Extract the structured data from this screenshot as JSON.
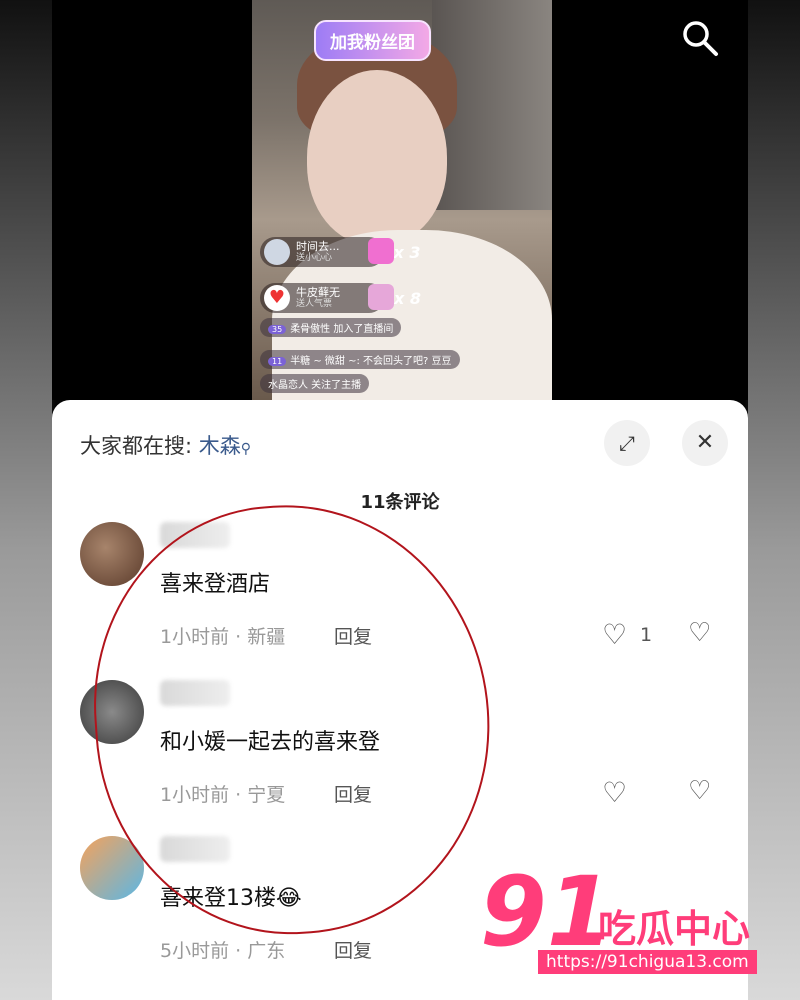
{
  "live": {
    "fan_badge": "加我粉丝团",
    "gifts": [
      {
        "title": "时间去...",
        "sub": "送小心心",
        "mult": "x 3"
      },
      {
        "title": "牛皮藓无",
        "sub": "送人气票",
        "mult": "x 8"
      }
    ],
    "chat": [
      {
        "level": "35",
        "text": "柔骨傲性 加入了直播间"
      },
      {
        "level": "11",
        "text": "半糖 ~ 微甜 ~: 不会回头了吧? 豆豆"
      },
      {
        "level": "",
        "text": "水晶恋人 关注了主播"
      }
    ]
  },
  "sheet": {
    "search_prefix": "大家都在搜:",
    "search_keyword": "木森",
    "comment_count": "11条评论",
    "comments": [
      {
        "text": "喜来登酒店",
        "meta": "1小时前 · 新疆",
        "reply": "回复",
        "likes": "1"
      },
      {
        "text": "和小媛一起去的喜来登",
        "meta": "1小时前 · 宁夏",
        "reply": "回复",
        "likes": ""
      },
      {
        "text": "喜来登13楼😂",
        "meta": "5小时前 · 广东",
        "reply": "回复",
        "likes": ""
      }
    ]
  },
  "watermark": {
    "number": "91",
    "brand": "吃瓜中心",
    "url": "https://91chigua13.com"
  },
  "colors": {
    "accent_pink": "#ff3d7a",
    "annotation_red": "#b2141c",
    "keyword_blue": "#3a5a8c"
  }
}
